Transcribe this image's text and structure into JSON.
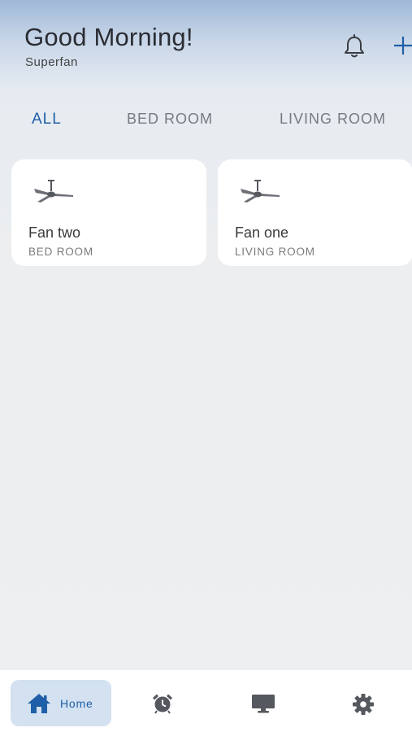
{
  "header": {
    "greeting": "Good Morning!",
    "app_name": "Superfan",
    "icons": [
      "bell-icon",
      "plus-icon"
    ]
  },
  "tabs": [
    {
      "label": "ALL",
      "active": true
    },
    {
      "label": "BED ROOM",
      "active": false
    },
    {
      "label": "LIVING ROOM",
      "active": false
    }
  ],
  "devices": [
    {
      "name": "Fan two",
      "room": "BED ROOM",
      "icon": "ceiling-fan-icon"
    },
    {
      "name": "Fan one",
      "room": "LIVING ROOM",
      "icon": "ceiling-fan-icon"
    }
  ],
  "bottom_nav": {
    "items": [
      {
        "label": "Home",
        "icon": "home-icon",
        "active": true
      },
      {
        "label": "",
        "icon": "alarm-clock-icon",
        "active": false
      },
      {
        "label": "",
        "icon": "monitor-icon",
        "active": false
      },
      {
        "label": "",
        "icon": "gear-icon",
        "active": false
      }
    ]
  },
  "colors": {
    "accent": "#1f5fa8",
    "active_nav_bg": "#d3e1f0",
    "card_bg": "#ffffff"
  }
}
